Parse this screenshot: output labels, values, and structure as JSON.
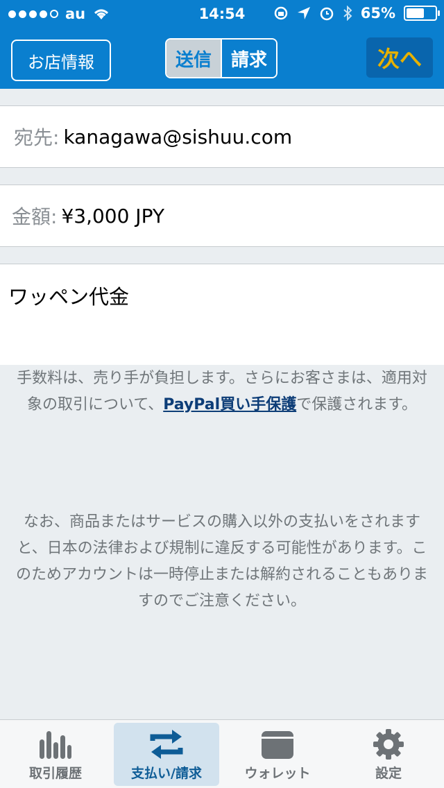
{
  "status": {
    "carrier": "au",
    "time": "14:54",
    "battery": "65%",
    "battery_level": 0.65
  },
  "header": {
    "store_info_label": "お店情報",
    "segment_send": "送信",
    "segment_request": "請求",
    "next_label": "次へ"
  },
  "form": {
    "to_label": "宛先:",
    "to_value": "kanagawa@sishuu.com",
    "amount_label": "金額:",
    "amount_value": "¥3,000 JPY",
    "memo": "ワッペン代金"
  },
  "notice": {
    "fee_text_before": "手数料は、売り手が負担します。さらにお客さまは、適用対象の取引について、",
    "fee_link": "PayPal買い手保護",
    "fee_text_after": "で保護されます。",
    "legal_text": "なお、商品またはサービスの購入以外の支払いをされますと、日本の法律および規制に違反する可能性があります。このためアカウントは一時停止または解約されることもありますのでご注意ください。"
  },
  "tabs": {
    "history": "取引履歴",
    "send_request": "支払い/請求",
    "wallet": "ウォレット",
    "settings": "設定"
  },
  "colors": {
    "header_blue": "#0a7fcf",
    "accent_gold": "#e7b100",
    "link_navy": "#0d3d77"
  }
}
